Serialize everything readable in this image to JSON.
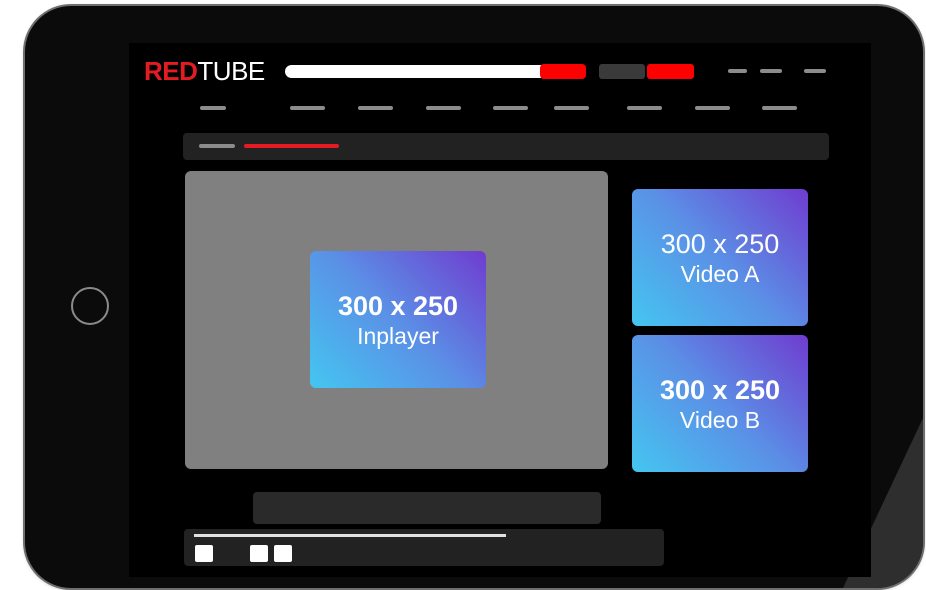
{
  "header": {
    "logo_red": "RED",
    "logo_white": "TUBE"
  },
  "ads": {
    "inplayer": {
      "size": "300 x 250",
      "name": "Inplayer"
    },
    "video_a": {
      "size": "300 x 250",
      "name": "Video A"
    },
    "video_b": {
      "size": "300 x 250",
      "name": "Video B"
    }
  },
  "colors": {
    "brand_red": "#e41b23",
    "button_red": "#ff0000",
    "player_gray": "#808080",
    "ad_gradient_start": "#44c6f0",
    "ad_gradient_end": "#6f3ccf"
  }
}
